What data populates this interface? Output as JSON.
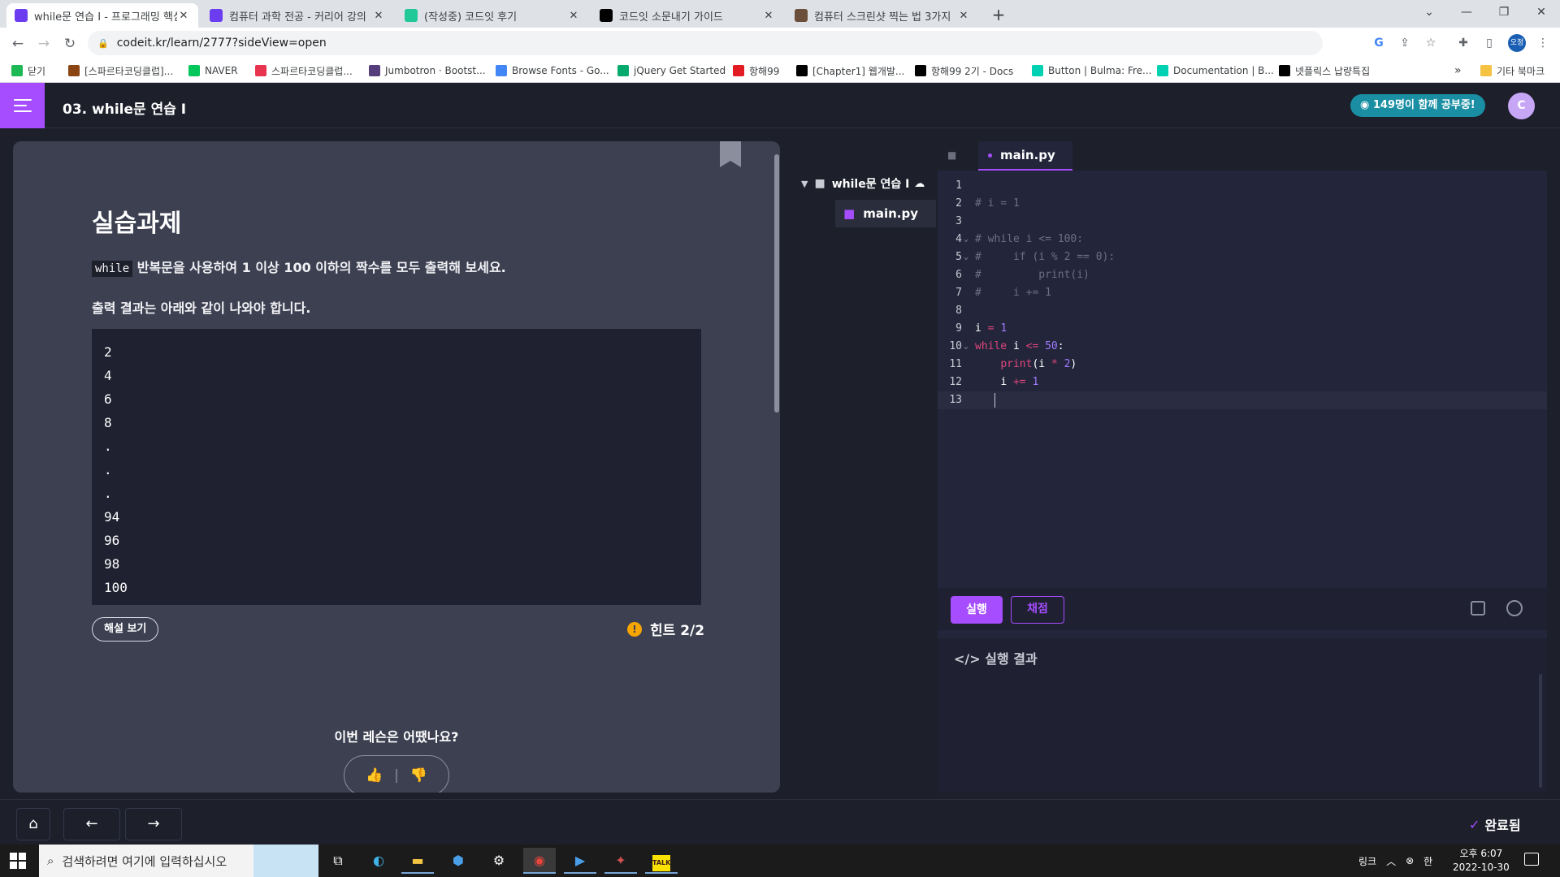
{
  "browser": {
    "tabs": [
      {
        "title": "while문 연습 I - 프로그래밍 핵심",
        "favicon": "codeit-icon",
        "color": "#6c3cf0",
        "active": true
      },
      {
        "title": "컴퓨터 과학 전공 - 커리어 강의",
        "favicon": "codeit-icon",
        "color": "#6c3cf0",
        "active": false
      },
      {
        "title": "(작성중) 코드잇 후기",
        "favicon": "velog-icon",
        "color": "#20c997",
        "active": false
      },
      {
        "title": "코드잇 소문내기 가이드",
        "favicon": "notion-icon",
        "color": "#000000",
        "active": false
      },
      {
        "title": "컴퓨터 스크린샷 찍는 법 3가지",
        "favicon": "tree-icon",
        "color": "#6b4f3a",
        "active": false
      }
    ],
    "new_tab": "+",
    "window_controls": [
      "⌄",
      "—",
      "❐",
      "✕"
    ],
    "url": "codeit.kr/learn/2777?sideView=open",
    "profile": "오정",
    "bookmarks": [
      {
        "label": "닫기",
        "color": "#1db954"
      },
      {
        "label": "[스파르타코딩클럽]...",
        "color": "#8b4513"
      },
      {
        "label": "NAVER",
        "color": "#03c75a"
      },
      {
        "label": "스파르타코딩클럽...",
        "color": "#e8344e"
      },
      {
        "label": "Jumbotron · Bootst...",
        "color": "#563d7c"
      },
      {
        "label": "Browse Fonts - Go...",
        "color": "#4285f4"
      },
      {
        "label": "jQuery Get Started",
        "color": "#04aa6d"
      },
      {
        "label": "항해99",
        "color": "#e31b23"
      },
      {
        "label": "[Chapter1] 웹개발...",
        "color": "#000000"
      },
      {
        "label": "항해99 2기 - Docs",
        "color": "#000000"
      },
      {
        "label": "Button | Bulma: Fre...",
        "color": "#00d1b2"
      },
      {
        "label": "Documentation | B...",
        "color": "#00d1b2"
      },
      {
        "label": "넷플릭스 납량특집",
        "color": "#000000"
      }
    ],
    "bookmarks_more": "»",
    "other_bookmarks": "기타 북마크"
  },
  "app": {
    "lesson_title": "03. while문 연습 I",
    "studying_badge": "149명이 함께 공부중!",
    "avatar_letter": "C",
    "accent": "#a64dff"
  },
  "lesson": {
    "heading": "실습과제",
    "instruction_code": "while",
    "instruction_text": " 반복문을 사용하여 1 이상 100 이하의 짝수를 모두 출력해 보세요.",
    "output_intro": "출력 결과는 아래와 같이 나와야 합니다.",
    "expected_output": [
      "2",
      "4",
      "6",
      "8",
      ".",
      ".",
      ".",
      "94",
      "96",
      "98",
      "100"
    ],
    "explain_button": "해설 보기",
    "hint_icon": "!",
    "hint_label": "힌트 2/2",
    "rating_question": "이번 레슨은 어땠나요?",
    "thumbs_up": "👍",
    "thumbs_down": "👎"
  },
  "file_tree": {
    "folder": "while문 연습 I",
    "file": "main.py"
  },
  "editor": {
    "tab": "main.py",
    "lines": [
      {
        "n": "1",
        "fold": false,
        "html": ""
      },
      {
        "n": "2",
        "fold": false,
        "html": "<span class='cmt'># i = 1</span>"
      },
      {
        "n": "3",
        "fold": false,
        "html": ""
      },
      {
        "n": "4",
        "fold": true,
        "html": "<span class='cmt'># while i &lt;= 100:</span>"
      },
      {
        "n": "5",
        "fold": true,
        "html": "<span class='cmt'>#     if (i % 2 == 0):</span>"
      },
      {
        "n": "6",
        "fold": false,
        "html": "<span class='cmt'>#         print(i)</span>"
      },
      {
        "n": "7",
        "fold": false,
        "html": "<span class='cmt'>#     i += 1</span>"
      },
      {
        "n": "8",
        "fold": false,
        "html": ""
      },
      {
        "n": "9",
        "fold": false,
        "html": "<span class='var'>i</span> <span class='op'>=</span> <span class='num-l'>1</span>"
      },
      {
        "n": "10",
        "fold": true,
        "html": "<span class='kw'>while</span> <span class='var'>i</span> <span class='op'>&lt;=</span> <span class='num-l'>50</span>:"
      },
      {
        "n": "11",
        "fold": false,
        "html": "    <span class='fn'>print</span>(<span class='var'>i</span> <span class='op'>*</span> <span class='num-l'>2</span>)"
      },
      {
        "n": "12",
        "fold": false,
        "html": "    <span class='var'>i</span> <span class='op'>+=</span> <span class='num-l'>1</span>"
      },
      {
        "n": "13",
        "fold": false,
        "html": "",
        "current": true
      }
    ],
    "run_button": "실행",
    "grade_button": "채점",
    "result_heading": "</> 실행 결과"
  },
  "bottom": {
    "home_icon": "⌂",
    "prev_icon": "←",
    "next_icon": "→",
    "done_check": "✓",
    "done_label": "완료됨"
  },
  "taskbar": {
    "search_placeholder": "검색하려면 여기에 입력하십시오",
    "apps": [
      "task-view",
      "edge",
      "file-explorer",
      "pin-app",
      "settings",
      "chrome",
      "remote-app",
      "game-app",
      "kakaotalk"
    ],
    "tray_link": "링크",
    "ime": "한",
    "time": "오후 6:07",
    "date": "2022-10-30"
  }
}
